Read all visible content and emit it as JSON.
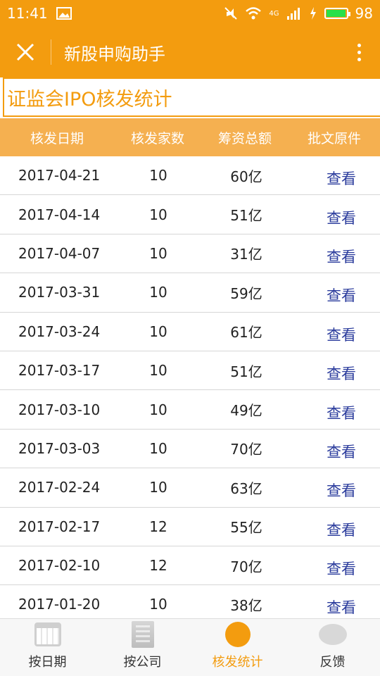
{
  "status_bar": {
    "time": "11:41",
    "battery_level": "98",
    "battery_fraction": 0.98,
    "network": "4G"
  },
  "header": {
    "title": "新股申购助手"
  },
  "section": {
    "title": "证监会IPO核发统计"
  },
  "table": {
    "columns": [
      "核发日期",
      "核发家数",
      "筹资总额",
      "批文原件"
    ],
    "rows": [
      {
        "date": "2017-04-21",
        "count": "10",
        "amount": "60亿",
        "action": "查看"
      },
      {
        "date": "2017-04-14",
        "count": "10",
        "amount": "51亿",
        "action": "查看"
      },
      {
        "date": "2017-04-07",
        "count": "10",
        "amount": "31亿",
        "action": "查看"
      },
      {
        "date": "2017-03-31",
        "count": "10",
        "amount": "59亿",
        "action": "查看"
      },
      {
        "date": "2017-03-24",
        "count": "10",
        "amount": "61亿",
        "action": "查看"
      },
      {
        "date": "2017-03-17",
        "count": "10",
        "amount": "51亿",
        "action": "查看"
      },
      {
        "date": "2017-03-10",
        "count": "10",
        "amount": "49亿",
        "action": "查看"
      },
      {
        "date": "2017-03-03",
        "count": "10",
        "amount": "70亿",
        "action": "查看"
      },
      {
        "date": "2017-02-24",
        "count": "10",
        "amount": "63亿",
        "action": "查看"
      },
      {
        "date": "2017-02-17",
        "count": "12",
        "amount": "55亿",
        "action": "查看"
      },
      {
        "date": "2017-02-10",
        "count": "12",
        "amount": "70亿",
        "action": "查看"
      },
      {
        "date": "2017-01-20",
        "count": "10",
        "amount": "38亿",
        "action": "查看"
      }
    ]
  },
  "bottom_nav": [
    {
      "label": "按日期",
      "icon": "calendar-icon",
      "active": false
    },
    {
      "label": "按公司",
      "icon": "building-icon",
      "active": false
    },
    {
      "label": "核发统计",
      "icon": "statistics-icon",
      "active": true
    },
    {
      "label": "反馈",
      "icon": "feedback-icon",
      "active": false
    }
  ],
  "colors": {
    "accent": "#f39c0f",
    "header_row": "#f5b050",
    "link": "#2a3b9c"
  }
}
